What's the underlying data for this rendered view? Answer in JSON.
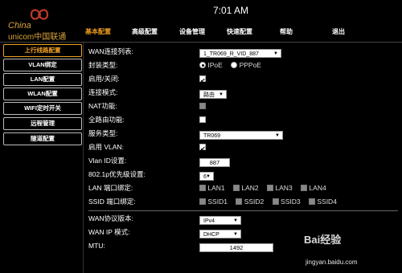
{
  "header": {
    "clock": "7:01 AM",
    "logo_cn": "China",
    "logo_en": "unicom中国联通"
  },
  "topnav": [
    "基本配置",
    "高级配置",
    "设备管理",
    "快速配置",
    "帮助",
    "退出"
  ],
  "sidebar": [
    "上行线路配置",
    "VLAN绑定",
    "LAN配置",
    "WLAN配置",
    "WIFI定时开关",
    "远程管理",
    "隧道配置"
  ],
  "form": {
    "wan_list_label": "WAN连接列表:",
    "wan_list_value": "1_TR069_R_VID_887",
    "encap_label": "封装类型:",
    "encap_opt1": "IPoE",
    "encap_opt2": "PPPoE",
    "enable_label": "启用/关闭:",
    "mode_label": "连接模式:",
    "mode_value": "路由",
    "nat_label": "NAT功能:",
    "fullcone_label": "全路由功能:",
    "service_label": "服务类型:",
    "service_value": "TR069",
    "vlan_enable_label": "启用 VLAN:",
    "vlan_id_label": "Vlan ID设置:",
    "vlan_id_value": "887",
    "priority_label": "802.1p优先级设置:",
    "priority_value": "6",
    "lan_bind_label": "LAN 端口绑定:",
    "lan_ports": [
      "LAN1",
      "LAN2",
      "LAN3",
      "LAN4"
    ],
    "ssid_bind_label": "SSID 端口绑定:",
    "ssid_ports": [
      "SSID1",
      "SSID2",
      "SSID3",
      "SSID4"
    ],
    "wan_proto_label": "WAN协议版本:",
    "wan_proto_value": "IPv4",
    "wan_ip_label": "WAN IP 模式:",
    "wan_ip_value": "DHCP",
    "mtu_label": "MTU:",
    "mtu_value": "1492"
  },
  "watermark": {
    "text": "Bai经验",
    "url": "jingyan.baidu.com"
  }
}
